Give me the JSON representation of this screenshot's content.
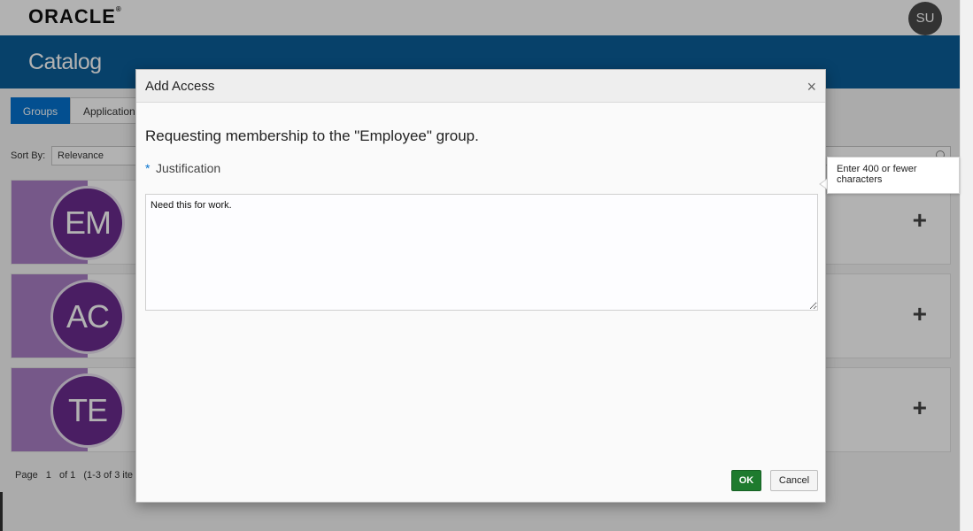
{
  "header": {
    "logo": "ORACLE",
    "logo_mark": "®",
    "user_initials": "SU"
  },
  "banner": {
    "title": "Catalog"
  },
  "tabs": [
    {
      "label": "Groups",
      "active": true
    },
    {
      "label": "Applications",
      "active": false
    }
  ],
  "sort": {
    "label": "Sort By:",
    "value": "Relevance"
  },
  "cards": [
    {
      "initials": "EM",
      "add": "+"
    },
    {
      "initials": "AC",
      "add": "+"
    },
    {
      "initials": "TE",
      "add": "+"
    }
  ],
  "pager": {
    "page_label": "Page",
    "page": "1",
    "of": "of 1",
    "range": "(1-3 of 3 ite"
  },
  "dialog": {
    "title": "Add Access",
    "close": "×",
    "message": "Requesting membership to the \"Employee\" group.",
    "required_mark": "*",
    "field_label": "Justification",
    "field_value": "Need this for work.",
    "tooltip": "Enter 400 or fewer characters",
    "ok_label": "OK",
    "cancel_label": "Cancel"
  },
  "colors": {
    "brand_blue": "#0b5d99",
    "active_tab": "#0572ce",
    "card_purple": "#6a2c8e",
    "ok_green": "#1e7b2e"
  }
}
